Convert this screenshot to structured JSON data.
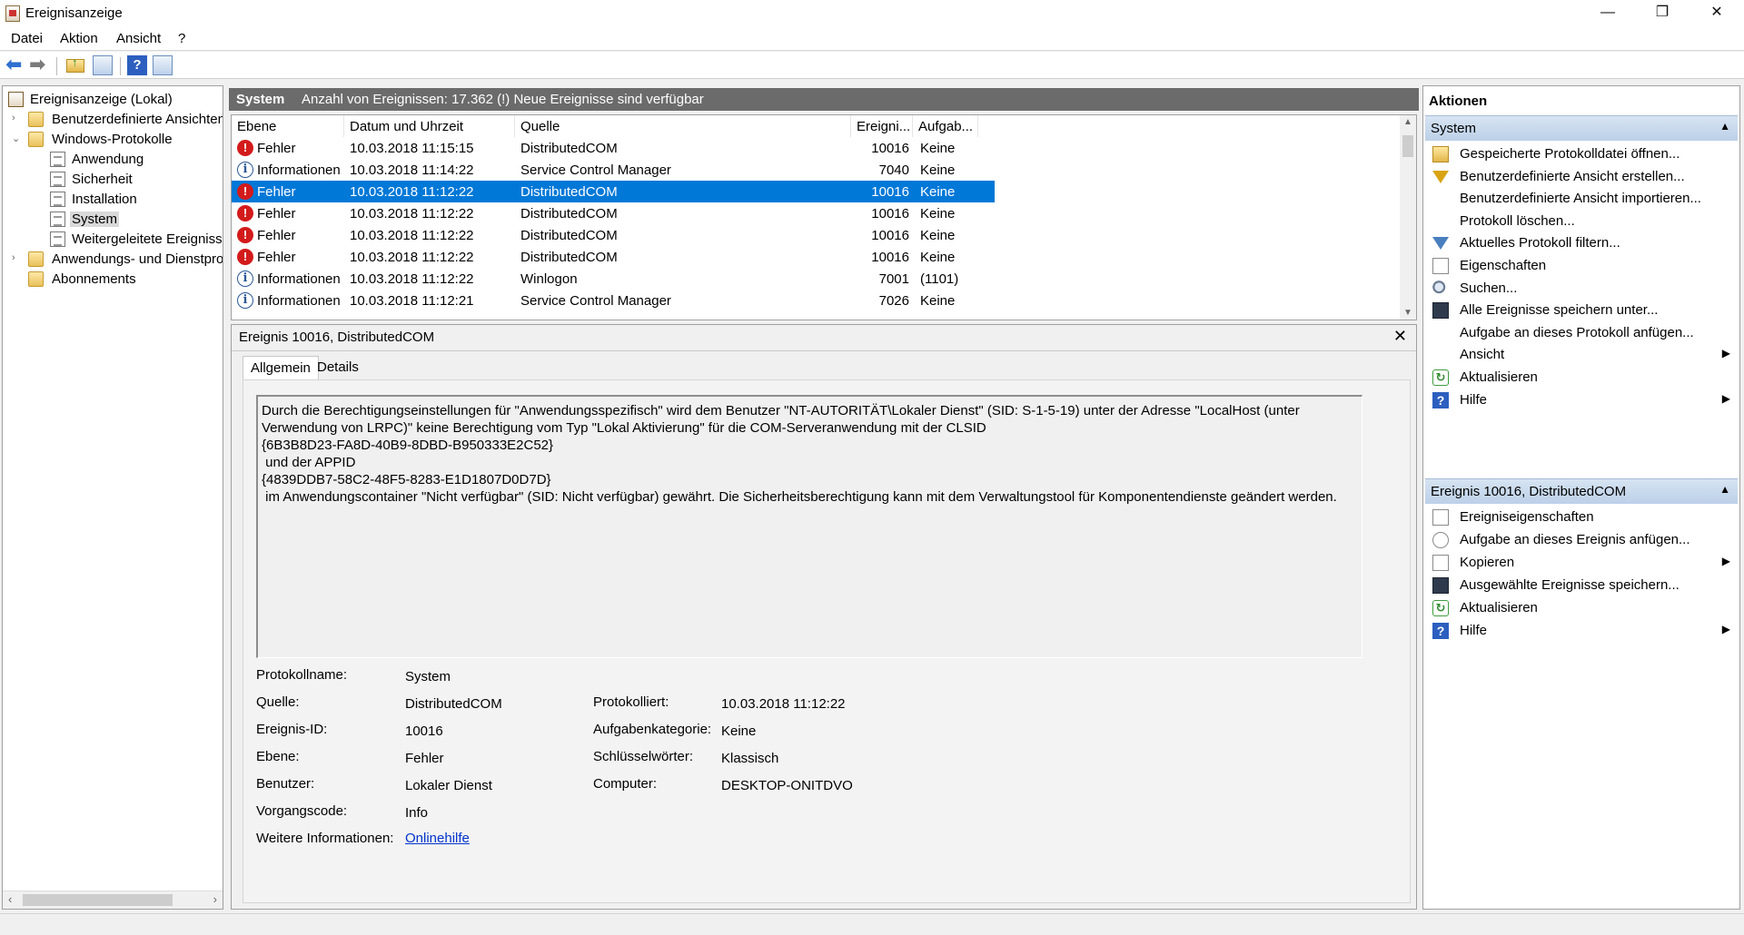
{
  "window": {
    "title": "Ereignisanzeige",
    "minimize": "—",
    "restore": "❐",
    "close": "✕"
  },
  "menu": [
    "Datei",
    "Aktion",
    "Ansicht",
    "?"
  ],
  "tree": {
    "root": "Ereignisanzeige (Lokal)",
    "custom_views": "Benutzerdefinierte Ansichten",
    "windows_logs": "Windows-Protokolle",
    "logs": [
      "Anwendung",
      "Sicherheit",
      "Installation",
      "System",
      "Weitergeleitete Ereignisse"
    ],
    "app_service_logs": "Anwendungs- und Dienstprotokolle",
    "subscriptions": "Abonnements",
    "selected": "System"
  },
  "center": {
    "log_name": "System",
    "event_count": "Anzahl von Ereignissen: 17.362 (!) Neue Ereignisse sind verfügbar",
    "columns": {
      "level": "Ebene",
      "datetime": "Datum und Uhrzeit",
      "source": "Quelle",
      "event_id": "Ereigni...",
      "task": "Aufgab..."
    },
    "events": [
      {
        "level": "Fehler",
        "type": "error",
        "datetime": "10.03.2018 11:15:15",
        "source": "DistributedCOM",
        "event_id": "10016",
        "task": "Keine"
      },
      {
        "level": "Informationen",
        "type": "info",
        "datetime": "10.03.2018 11:14:22",
        "source": "Service Control Manager",
        "event_id": "7040",
        "task": "Keine"
      },
      {
        "level": "Fehler",
        "type": "error",
        "datetime": "10.03.2018 11:12:22",
        "source": "DistributedCOM",
        "event_id": "10016",
        "task": "Keine",
        "selected": true
      },
      {
        "level": "Fehler",
        "type": "error",
        "datetime": "10.03.2018 11:12:22",
        "source": "DistributedCOM",
        "event_id": "10016",
        "task": "Keine"
      },
      {
        "level": "Fehler",
        "type": "error",
        "datetime": "10.03.2018 11:12:22",
        "source": "DistributedCOM",
        "event_id": "10016",
        "task": "Keine"
      },
      {
        "level": "Fehler",
        "type": "error",
        "datetime": "10.03.2018 11:12:22",
        "source": "DistributedCOM",
        "event_id": "10016",
        "task": "Keine"
      },
      {
        "level": "Informationen",
        "type": "info",
        "datetime": "10.03.2018 11:12:22",
        "source": "Winlogon",
        "event_id": "7001",
        "task": "(1101)"
      },
      {
        "level": "Informationen",
        "type": "info",
        "datetime": "10.03.2018 11:12:21",
        "source": "Service Control Manager",
        "event_id": "7026",
        "task": "Keine"
      }
    ]
  },
  "detail": {
    "title": "Ereignis 10016, DistributedCOM",
    "close": "✕",
    "tabs": [
      "Allgemein",
      "Details"
    ],
    "description": "Durch die Berechtigungseinstellungen für \"Anwendungsspezifisch\" wird dem Benutzer \"NT-AUTORITÄT\\Lokaler Dienst\" (SID: S-1-5-19) unter der Adresse \"LocalHost (unter\nVerwendung von LRPC)\" keine Berechtigung vom Typ \"Lokal Aktivierung\" für die COM-Serveranwendung mit der CLSID\n{6B3B8D23-FA8D-40B9-8DBD-B950333E2C52}\n und der APPID\n{4839DDB7-58C2-48F5-8283-E1D1807D0D7D}\n im Anwendungscontainer \"Nicht verfügbar\" (SID: Nicht verfügbar) gewährt. Die Sicherheitsberechtigung kann mit dem Verwaltungstool für Komponentendienste geändert werden.",
    "labels": {
      "log_name": "Protokollname:",
      "source": "Quelle:",
      "event_id": "Ereignis-ID:",
      "level": "Ebene:",
      "user": "Benutzer:",
      "opcode": "Vorgangscode:",
      "more_info": "Weitere Informationen:",
      "logged": "Protokolliert:",
      "task_category": "Aufgabenkategorie:",
      "keywords": "Schlüsselwörter:",
      "computer": "Computer:"
    },
    "values": {
      "log_name": "System",
      "source": "DistributedCOM",
      "event_id": "10016",
      "level": "Fehler",
      "user": "Lokaler Dienst",
      "opcode": "Info",
      "more_info": "Onlinehilfe",
      "logged": "10.03.2018 11:12:22",
      "task_category": "Keine",
      "keywords": "Klassisch",
      "computer": "DESKTOP-ONITDVO"
    }
  },
  "actions": {
    "title": "Aktionen",
    "group1": {
      "title": "System",
      "items": [
        {
          "label": "Gespeicherte Protokolldatei öffnen...",
          "icon": "open-folder-icon"
        },
        {
          "label": "Benutzerdefinierte Ansicht erstellen...",
          "icon": "filter-icon"
        },
        {
          "label": "Benutzerdefinierte Ansicht importieren...",
          "icon": ""
        },
        {
          "label": "Protokoll löschen...",
          "icon": ""
        },
        {
          "label": "Aktuelles Protokoll filtern...",
          "icon": "filter-icon"
        },
        {
          "label": "Eigenschaften",
          "icon": "properties-icon"
        },
        {
          "label": "Suchen...",
          "icon": "binoculars-icon"
        },
        {
          "label": "Alle Ereignisse speichern unter...",
          "icon": "save-icon"
        },
        {
          "label": "Aufgabe an dieses Protokoll anfügen...",
          "icon": ""
        },
        {
          "label": "Ansicht",
          "icon": "",
          "submenu": true
        },
        {
          "label": "Aktualisieren",
          "icon": "refresh-icon"
        },
        {
          "label": "Hilfe",
          "icon": "help-icon",
          "submenu": true
        }
      ]
    },
    "group2": {
      "title": "Ereignis 10016, DistributedCOM",
      "items": [
        {
          "label": "Ereigniseigenschaften",
          "icon": "properties-icon"
        },
        {
          "label": "Aufgabe an dieses Ereignis anfügen...",
          "icon": "task-icon"
        },
        {
          "label": "Kopieren",
          "icon": "copy-icon",
          "submenu": true
        },
        {
          "label": "Ausgewählte Ereignisse speichern...",
          "icon": "save-icon"
        },
        {
          "label": "Aktualisieren",
          "icon": "refresh-icon"
        },
        {
          "label": "Hilfe",
          "icon": "help-icon",
          "submenu": true
        }
      ]
    }
  }
}
